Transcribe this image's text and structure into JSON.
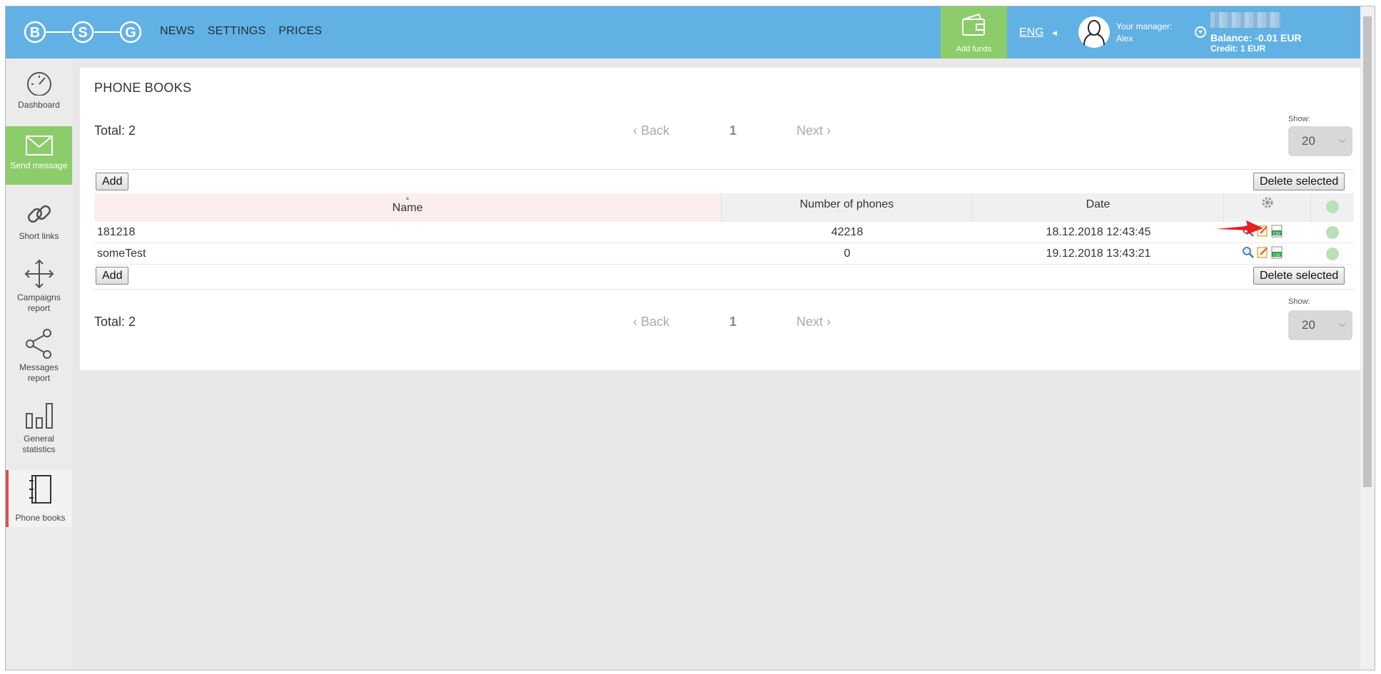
{
  "header": {
    "logo_letters": [
      "B",
      "S",
      "G"
    ],
    "nav": [
      "NEWS",
      "SETTINGS",
      "PRICES"
    ],
    "add_funds": "Add funds",
    "lang": "ENG",
    "manager_label": "Your manager:",
    "manager_name": "Alex",
    "balance": "Balance: -0.01 EUR",
    "credit": "Credit: 1 EUR"
  },
  "sidebar": {
    "items": [
      {
        "label": "Dashboard",
        "icon": "speedometer-icon"
      },
      {
        "label": "Send message",
        "icon": "envelope-icon"
      },
      {
        "label": "Short links",
        "icon": "link-icon"
      },
      {
        "label": "Campaigns report",
        "icon": "move-arrows-icon"
      },
      {
        "label": "Messages report",
        "icon": "share-icon"
      },
      {
        "label": "General statistics",
        "icon": "bar-chart-icon"
      },
      {
        "label": "Phone books",
        "icon": "notebook-icon"
      }
    ]
  },
  "page": {
    "title": "PHONE BOOKS",
    "total_top": "Total: 2",
    "total_bottom": "Total: 2",
    "pager": {
      "back": "Back",
      "page": "1",
      "next": "Next"
    },
    "show_label": "Show:",
    "show_value": "20",
    "add_label": "Add",
    "delete_label": "Delete selected"
  },
  "table": {
    "columns": [
      "Name",
      "Number of phones",
      "Date"
    ],
    "rows": [
      {
        "name": "181218",
        "phones": "42218",
        "date": "18.12.2018 12:43:45"
      },
      {
        "name": "someTest",
        "phones": "0",
        "date": "19.12.2018 13:43:21"
      }
    ]
  },
  "colors": {
    "header_bg": "#62b1e4",
    "accent_green": "#8ccc6b",
    "active_red": "#d9534f",
    "sort_column_bg": "#fdeded"
  }
}
